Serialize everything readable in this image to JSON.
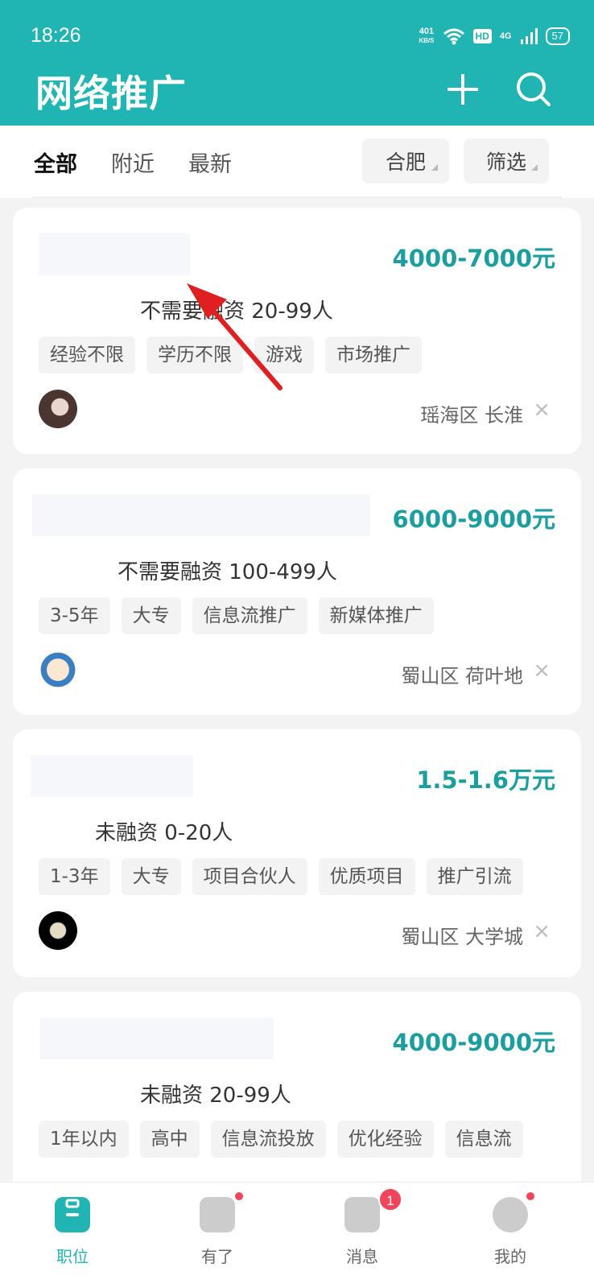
{
  "status_bar": {
    "time": "18:26",
    "net_speed_value": "401",
    "net_speed_unit": "KB/S",
    "hd": "HD",
    "net_type": "4G",
    "battery": "57"
  },
  "header": {
    "title": "网络推广",
    "add_icon": "plus-icon",
    "search_icon": "search-icon",
    "bg_color": "#20b5b2"
  },
  "filters": {
    "tabs": [
      "全部",
      "附近",
      "最新"
    ],
    "active_tab": "全部",
    "city": "合肥",
    "filter": "筛选"
  },
  "jobs": [
    {
      "salary": "4000-7000元",
      "company": "不需要融资  20-99人",
      "tags": [
        "经验不限",
        "学历不限",
        "游戏",
        "市场推广"
      ],
      "location": "瑶海区  长淮"
    },
    {
      "salary": "6000-9000元",
      "company": "不需要融资  100-499人",
      "tags": [
        "3-5年",
        "大专",
        "信息流推广",
        "新媒体推广"
      ],
      "location": "蜀山区  荷叶地"
    },
    {
      "salary": "1.5-1.6万元",
      "company": "未融资  0-20人",
      "tags": [
        "1-3年",
        "大专",
        "项目合伙人",
        "优质项目",
        "推广引流"
      ],
      "location": "蜀山区  大学城"
    },
    {
      "salary": "4000-9000元",
      "company": "未融资  20-99人",
      "tags": [
        "1年以内",
        "高中",
        "信息流投放",
        "优化经验",
        "信息流"
      ],
      "location": ""
    }
  ],
  "tabbar": {
    "items": [
      {
        "label": "职位",
        "icon": "briefcase-icon"
      },
      {
        "label": "有了",
        "icon": "book-icon"
      },
      {
        "label": "消息",
        "icon": "chat-icon",
        "badge": "1"
      },
      {
        "label": "我的",
        "icon": "profile-icon"
      }
    ]
  },
  "accent_color": "#1b9ea0",
  "close_glyph": "×"
}
